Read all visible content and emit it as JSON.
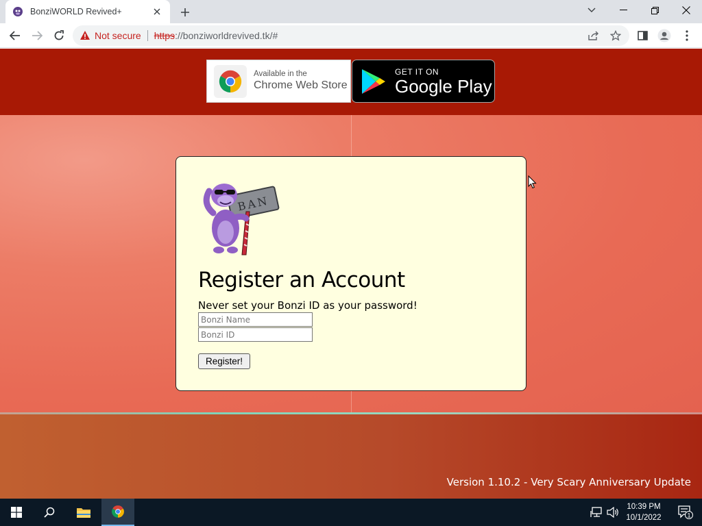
{
  "browser": {
    "tab_title": "BonziWORLD Revived+",
    "security_label": "Not secure",
    "url_scheme": "https",
    "url_rest": "://bonziworldrevived.tk/#"
  },
  "store_badges": {
    "chrome": {
      "small": "Available in the",
      "big": "Chrome Web Store"
    },
    "google_play": {
      "small": "GET IT ON",
      "big": "Google Play"
    }
  },
  "mascot": {
    "hammer_text": "BAN"
  },
  "register": {
    "title": "Register an Account",
    "warning": "Never set your Bonzi ID as your password!",
    "name_placeholder": "Bonzi Name",
    "id_placeholder": "Bonzi ID",
    "button_label": "Register!"
  },
  "footer": {
    "version": "Version 1.10.2 - Very Scary Anniversary Update"
  },
  "taskbar": {
    "time": "10:39 PM",
    "date": "10/1/2022",
    "notification_count": "1"
  },
  "colors": {
    "header": "#a81905",
    "card": "#ffffe0",
    "taskbar": "#0b1825"
  }
}
